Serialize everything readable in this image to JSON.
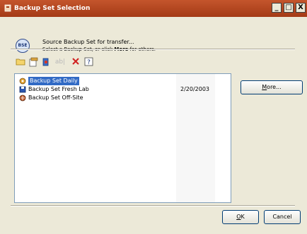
{
  "window": {
    "title": "Backup Set Selection",
    "app_icon": "backup-app-icon",
    "controls": {
      "minimize": "_",
      "maximize": "□",
      "close": "X"
    }
  },
  "header": {
    "icon_text": "BSE",
    "line1": "Source Backup Set for transfer...",
    "line2_prefix": "Select a Backup Set, or click ",
    "line2_bold": "More",
    "line2_suffix": " for others."
  },
  "toolbar": {
    "items": [
      {
        "name": "new-folder-icon",
        "enabled": true
      },
      {
        "name": "properties-icon",
        "enabled": true
      },
      {
        "name": "settings-icon",
        "enabled": true
      },
      {
        "name": "rename-icon",
        "enabled": false
      },
      {
        "name": "delete-icon",
        "enabled": true
      },
      {
        "name": "help-icon",
        "enabled": true
      }
    ]
  },
  "list": {
    "items": [
      {
        "label": "Backup Set Daily",
        "date": "",
        "icon": "backup-set-icon",
        "selected": true
      },
      {
        "label": "Backup Set Fresh Lab",
        "date": "2/20/2003",
        "icon": "floppy-disk-icon",
        "selected": false
      },
      {
        "label": "Backup Set Off-Site",
        "date": "",
        "icon": "network-icon",
        "selected": false
      }
    ]
  },
  "buttons": {
    "more_pre": "",
    "more_ul": "M",
    "more_post": "ore...",
    "ok_ul": "O",
    "ok_post": "K",
    "cancel": "Cancel"
  },
  "colors": {
    "titlebar": "#b34a22",
    "selection": "#316ac5",
    "dialog_bg": "#ece9d8"
  }
}
